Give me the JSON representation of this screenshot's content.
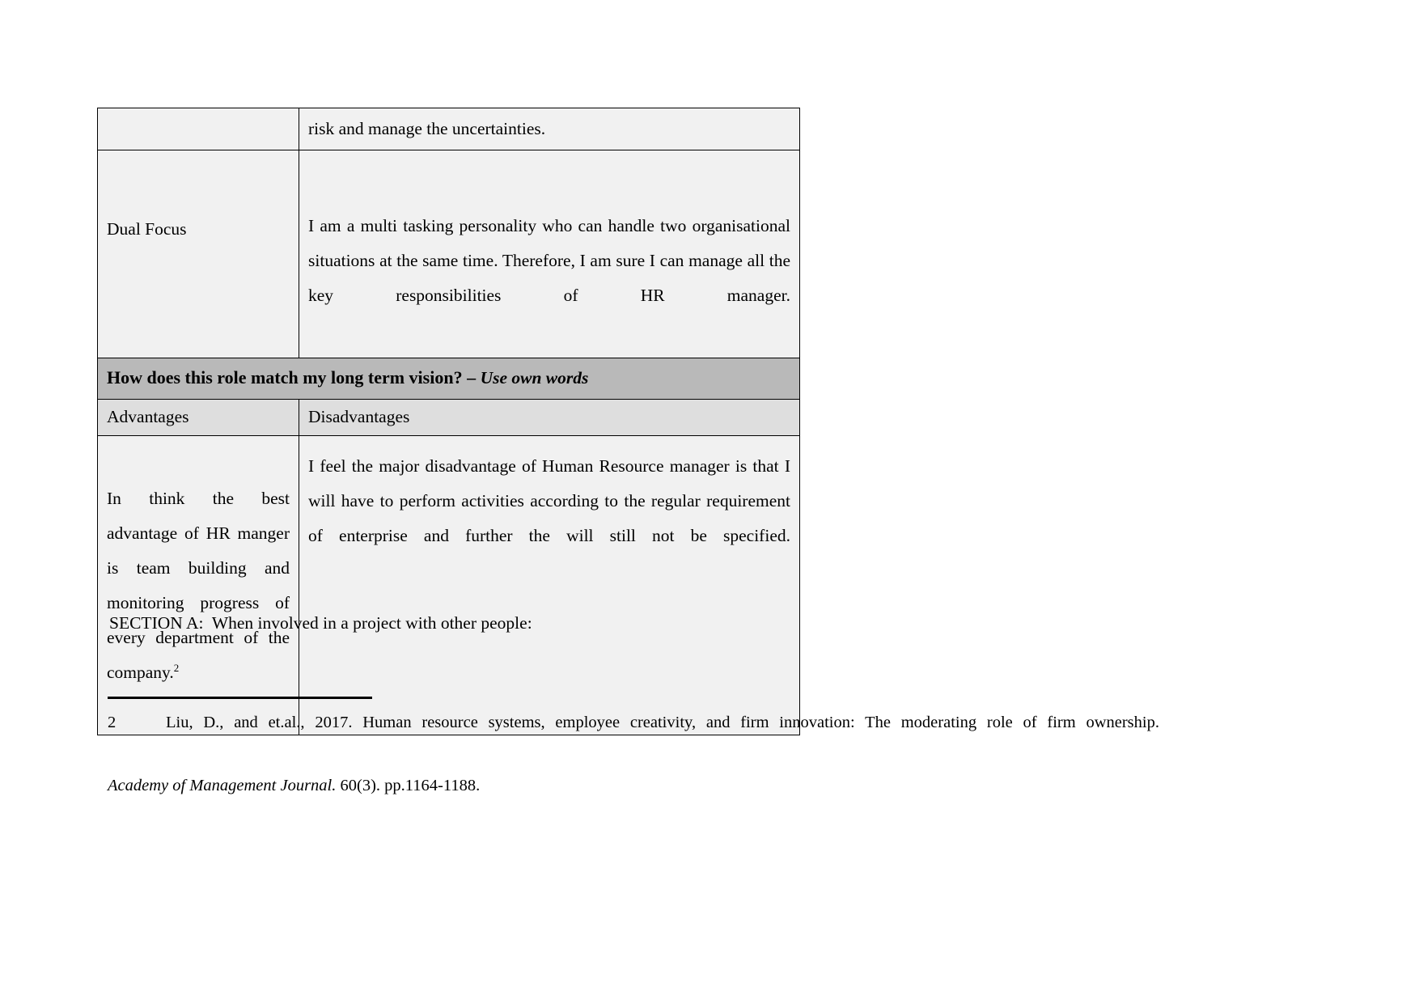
{
  "document": {
    "table": {
      "rows": [
        {
          "type": "partial",
          "label": "",
          "body": "risk and manage the uncertainties."
        },
        {
          "type": "labeled",
          "label": "Dual Focus",
          "body": "I am a multi tasking personality who can handle two organisational situations at the same time. Therefore, I am sure I can manage all the key responsibilities of HR manager."
        }
      ],
      "banner": {
        "question": "How does this role match my long term vision? – ",
        "instruction": "Use own words"
      },
      "subheaders": {
        "advantages": "Advantages",
        "disadvantages": "Disadvantages"
      },
      "body_cells": {
        "advantages": "In think the best advantage of HR manger is team building and monitoring progress of every department of the company.",
        "advantages_footnote_marker": "2",
        "disadvantages": "I feel the major disadvantage of Human Resource manager is that I will have to perform activities according to the regular requirement of enterprise and further the will still not be specified."
      }
    },
    "section_line": "SECTION A:  When involved in a project with other people:",
    "footnote": {
      "number": "2",
      "text_before_italic": "Liu, D., and et.al., 2017. Human resource systems, employee creativity, and firm innovation: The moderating role of firm ownership.",
      "italic_title": "Academy of Management Journal.",
      "text_after_italic": " 60(3). pp.1164-1188."
    }
  },
  "colors": {
    "page_background": "#ffffff",
    "table_cell_background": "#f1f1f1",
    "banner_background": "#b9b9b9",
    "subheader_background": "#dedede",
    "border": "#000000",
    "text": "#000000"
  }
}
